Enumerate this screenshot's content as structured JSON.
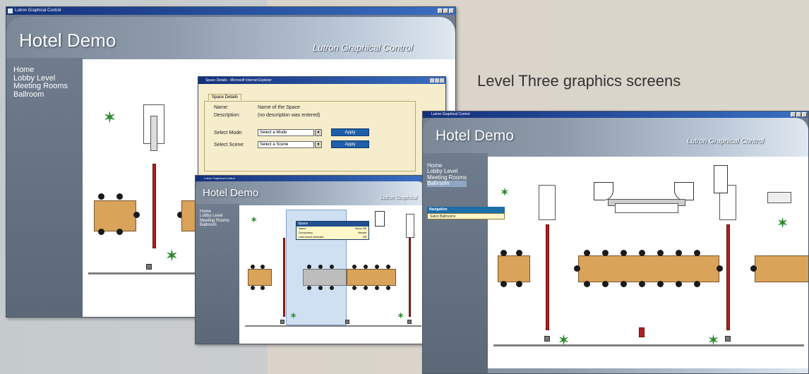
{
  "caption": "Level Three graphics screens",
  "windows": {
    "left": {
      "titlebar": "Lutron Graphical Control",
      "app_title": "Hotel Demo",
      "app_subtitle": "Lutron Graphical Control",
      "menu": [
        "Home",
        "Lobby Level",
        "Meeting Rooms",
        "Ballroom"
      ]
    },
    "dialog": {
      "titlebar": "Space Details - Microsoft Internet Explorer",
      "tab": "Space Details",
      "name_label": "Name:",
      "name_value": "Name of the Space",
      "description_label": "Description:",
      "description_value": "(no description was entered)",
      "mode_label": "Select Mode:",
      "mode_value": "Select a Mode",
      "scene_label": "Select Scene:",
      "scene_value": "Select a Scene",
      "apply_label": "Apply"
    },
    "middle": {
      "titlebar": "Lutron Graphical Control",
      "app_title": "Hotel Demo",
      "app_subtitle": "Lutron Graphical",
      "menu": [
        "Home",
        "Lobby Level",
        "Meeting Rooms",
        "Ballroom"
      ],
      "popup": {
        "title": "Space",
        "rows": [
          {
            "k": "Name",
            "v": "Salon 3B"
          },
          {
            "k": "Occupancy",
            "v": "Vacant"
          },
          {
            "k": "Last scene selected",
            "v": "Off"
          }
        ]
      }
    },
    "right": {
      "titlebar": "Lutron Graphical Control",
      "app_title": "Hotel Demo",
      "app_subtitle": "Lutron Graphical Control",
      "menu": [
        "Home",
        "Lobby Level",
        "Meeting Rooms",
        "Ballroom"
      ],
      "submenu": [
        "Navigation",
        "Salon Ballrooms"
      ]
    }
  }
}
